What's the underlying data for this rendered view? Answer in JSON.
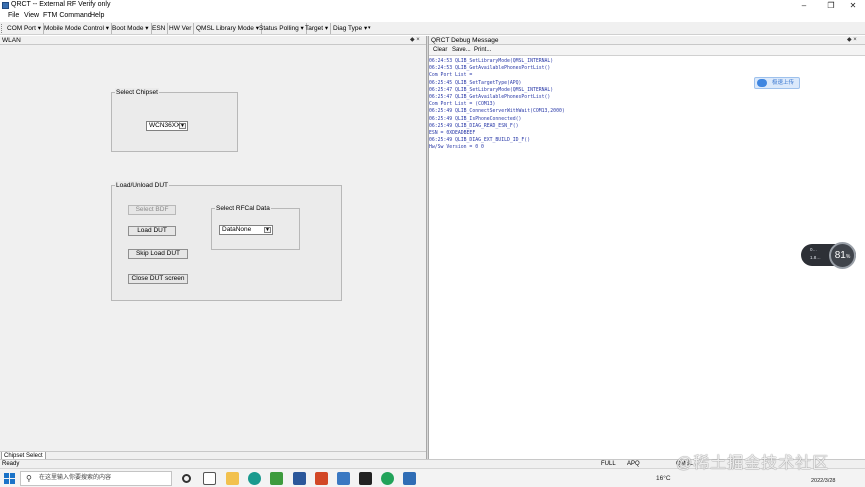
{
  "window": {
    "title": "QRCT -- External RF Verify only"
  },
  "menu": [
    "File",
    "View",
    "FTM Command",
    "Help"
  ],
  "toolbar": {
    "items": [
      "COM Port",
      "Mobile Mode Control",
      "Boot Mode",
      "ESN",
      "HW Ver",
      "QMSL Library Mode",
      "Status Polling",
      "Target",
      "Diag Type"
    ]
  },
  "left_panel": {
    "header": "WLAN",
    "header_controls": "◆ ×",
    "chipset_group": {
      "label": "Select Chipset",
      "selected": "WCN36XX"
    },
    "dut_group": {
      "label": "Load/Unload DUT",
      "buttons": {
        "select_bdf": "Select BDF",
        "load_dut": "Load DUT",
        "skip_load_dut": "Skip Load DUT",
        "close_dut_screen": "Close DUT screen"
      },
      "rfcal_group": {
        "label": "Select RFCal Data",
        "selected": "DataNone"
      }
    },
    "tab": "Chipset Select"
  },
  "debug_panel": {
    "header": "QRCT Debug Message",
    "header_controls": "◆ ×",
    "buttons": {
      "clear": "Clear",
      "save": "Save...",
      "print": "Print..."
    },
    "log_lines": [
      "06:24:53  QLIB_SetLibraryMode(QMSL_INTERNAL)",
      "06:24:53  QLIB_GetAvailablePhonesPortList()",
      "Com Port List =",
      "06:25:45  QLIB_SetTargetType(APQ)",
      "06:25:47  QLIB_SetLibraryMode(QMSL_INTERNAL)",
      "06:25:47  QLIB_GetAvailablePhonesPortList()",
      "Com Port List = (COM13)",
      "06:25:49  QLIB_ConnectServerWithWait(COM13,2000)",
      "06:25:49  QLIB_IsPhoneConnected()",
      "06:25:49  QLIB_DIAG_READ_ESN_F()",
      "ESN = 0XDEADBEEF",
      "06:25:49  QLIB_DIAG_EXT_BUILD_ID_F()",
      "Hw/Sw Version = 0  0"
    ]
  },
  "cloud_widget": {
    "label": "极速上传"
  },
  "perf_widget": {
    "line1": "0…",
    "line2": "1.8…",
    "percent": "81",
    "percent_suffix": "%"
  },
  "statusbar": {
    "status": "Ready",
    "mode": "FULL",
    "target": "APQ",
    "lib": "QMSL"
  },
  "watermark": "@稀土掘金技术社区",
  "taskbar": {
    "search_placeholder": "在这里输入你要搜索的内容",
    "temperature": "16°C",
    "date": "2022/3/28"
  },
  "colors": {
    "log_text": "#2a3aa8",
    "pane_background": "#f0f0f0",
    "cloud_widget_text": "#3b78d0"
  }
}
